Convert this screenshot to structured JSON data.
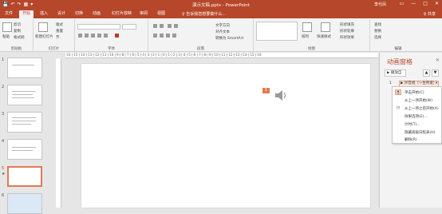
{
  "titlebar": {
    "title": "演示文稿.pptx - PowerPoint",
    "user": "李代凤",
    "qat": [
      "💾",
      "↶",
      "↷",
      "▦",
      "▾"
    ],
    "winbtns": [
      "▭",
      "—",
      "□",
      "✕"
    ]
  },
  "tabs": [
    "文件",
    "开始",
    "插入",
    "设计",
    "切换",
    "动画",
    "幻灯片放映",
    "审阅",
    "视图"
  ],
  "tell_me": "♀ 告诉我您想要做什么...",
  "share": "♀ 共享",
  "ribbon": {
    "clipboard": {
      "paste": "粘贴",
      "cut": "剪切",
      "copy": "复制",
      "format": "格式刷",
      "label": "剪贴板"
    },
    "slides": {
      "new": "新建幻灯片",
      "layout": "版式",
      "reset": "重置",
      "section": "节",
      "label": "幻灯片"
    },
    "font": {
      "label": "字体"
    },
    "paragraph": {
      "text_dir": "文字方向",
      "align": "对齐文本",
      "smartart": "转换为 SmartArt",
      "label": "段落"
    },
    "drawing": {
      "arrange": "排列",
      "styles": "快速样式",
      "fill": "形状填充",
      "outline": "形状轮廓",
      "effect": "形状效果",
      "label": "绘图"
    },
    "editing": {
      "find": "查找",
      "replace": "替换",
      "select": "选择",
      "label": "编辑"
    }
  },
  "ruler_text": "·16·|·15·|·14·|·13·|·12·|·11·|·10·|·9·|·8·|·7·|·6·|·5·|·4·|·3·|·2·|·1·|·0·|·1·|·2·|·3·|·4·|·5·|·6·|·7·|·8·|·9·|·10·|·11·|·12·|·13·|·14·|·15·|·16·",
  "thumbnails": [
    {
      "num": "1",
      "star": ""
    },
    {
      "num": "2",
      "star": ""
    },
    {
      "num": "3",
      "star": ""
    },
    {
      "num": "4",
      "star": ""
    },
    {
      "num": "5",
      "star": "★"
    },
    {
      "num": "6",
      "star": ""
    }
  ],
  "slide": {
    "anim_tag": "1"
  },
  "pane": {
    "title": "动画窗格",
    "close": "✕",
    "play": "▶ 播放自",
    "arrows": [
      "▲",
      "▼"
    ],
    "item_num": "1",
    "item_label": "▶ 声音组（一生所爱）",
    "item_arrow": "▾"
  },
  "menu": {
    "items": [
      {
        "icon": "🖱",
        "label": "单击开始(C)"
      },
      {
        "icon": "",
        "label": "从上一项开始(W)"
      },
      {
        "icon": "◷",
        "label": "从上一项之后开始(A)"
      },
      {
        "icon": "",
        "label": "效果选项(E)..."
      },
      {
        "icon": "",
        "label": "计时(T)..."
      },
      {
        "icon": "",
        "label": "隐藏高级日程表(H)"
      },
      {
        "icon": "",
        "label": "删除(R)"
      }
    ]
  },
  "colors": {
    "accent": "#b7472a",
    "highlight": "#e07b53"
  }
}
